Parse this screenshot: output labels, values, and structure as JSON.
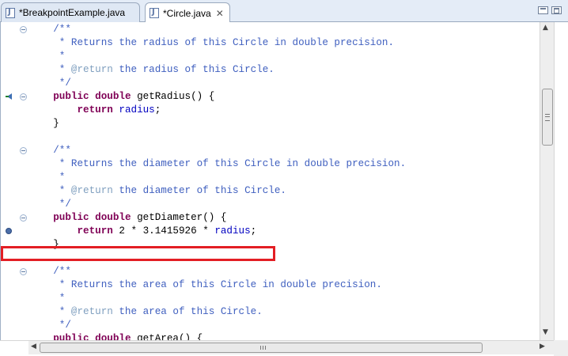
{
  "tabs": [
    {
      "label": "*BreakpointExample.java",
      "active": false
    },
    {
      "label": "*Circle.java",
      "active": true
    }
  ],
  "code_lines": [
    {
      "text": "    /**"
    },
    {
      "text": "     * Returns the radius of this Circle in double precision."
    },
    {
      "text": "     *"
    },
    {
      "text": "     * @return the radius of this Circle."
    },
    {
      "text": "     */"
    },
    {
      "text": "    public double getRadius() {"
    },
    {
      "text": "        return radius;"
    },
    {
      "text": "    }"
    },
    {
      "text": ""
    },
    {
      "text": "    /**"
    },
    {
      "text": "     * Returns the diameter of this Circle in double precision."
    },
    {
      "text": "     *"
    },
    {
      "text": "     * @return the diameter of this Circle."
    },
    {
      "text": "     */"
    },
    {
      "text": "    public double getDiameter() {"
    },
    {
      "text": "        return 2 * 3.1415926 * radius;"
    },
    {
      "text": "    }"
    },
    {
      "text": ""
    },
    {
      "text": "    /**"
    },
    {
      "text": "     * Returns the area of this Circle in double precision."
    },
    {
      "text": "     *"
    },
    {
      "text": "     * @return the area of this Circle."
    },
    {
      "text": "     */"
    },
    {
      "text": "    public double getArea() {"
    }
  ],
  "icons": {
    "tab_file": "java-file-icon",
    "tab_close": "close-icon",
    "fold": "fold-collapse-icon",
    "override": "override-marker-icon",
    "breakpoint": "breakpoint-icon"
  },
  "colors": {
    "keyword": "#7f0055",
    "comment": "#3f5fbf",
    "javadoc_tag": "#7f9fbf",
    "field": "#0000c0",
    "highlight_box": "#e31e24"
  }
}
